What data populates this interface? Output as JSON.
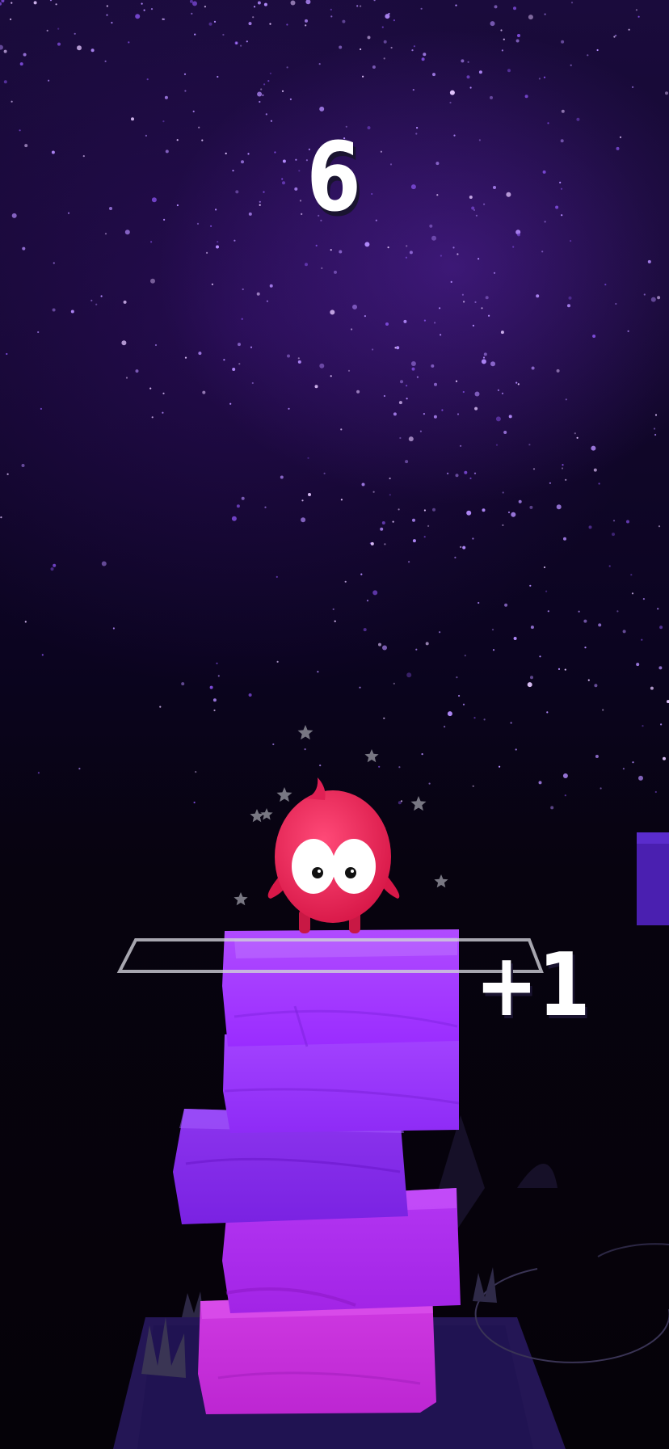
{
  "game": {
    "score": "6",
    "bonus_popup": "+1"
  },
  "character": {
    "body_color": "#f0275a",
    "eye_color": "#ffffff",
    "pupil_color": "#111111"
  },
  "tower": {
    "block_colors": [
      "#a22cff",
      "#9c2fff",
      "#8a2ef2",
      "#b52bf0",
      "#c62ad8"
    ],
    "target_outline_color": "#d8d8e0"
  },
  "background": {
    "sky_colors": [
      "#1a0b3c",
      "#07030f"
    ],
    "star_color": "#b58cff"
  },
  "particles": {
    "sparkle_icon": "star-icon",
    "sparkle_color": "#8c8c96"
  }
}
